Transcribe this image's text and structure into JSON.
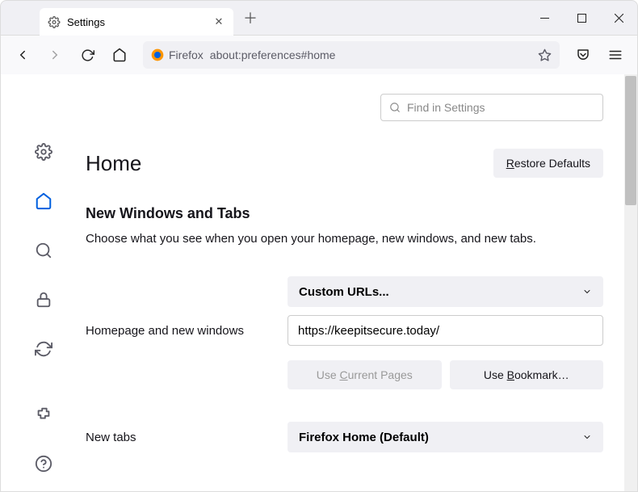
{
  "window": {
    "tab_title": "Settings"
  },
  "urlbar": {
    "identity": "Firefox",
    "path": "about:preferences#home"
  },
  "search": {
    "placeholder": "Find in Settings"
  },
  "page": {
    "title": "Home",
    "restore_defaults": "Restore Defaults",
    "section": {
      "heading": "New Windows and Tabs",
      "desc": "Choose what you see when you open your homepage, new windows, and new tabs."
    },
    "homepage": {
      "label": "Homepage and new windows",
      "mode": "Custom URLs...",
      "url": "https://keepitsecure.today/",
      "use_current": "Use Current Pages",
      "use_bookmark": "Use Bookmark…"
    },
    "newtabs": {
      "label": "New tabs",
      "mode": "Firefox Home (Default)"
    }
  }
}
